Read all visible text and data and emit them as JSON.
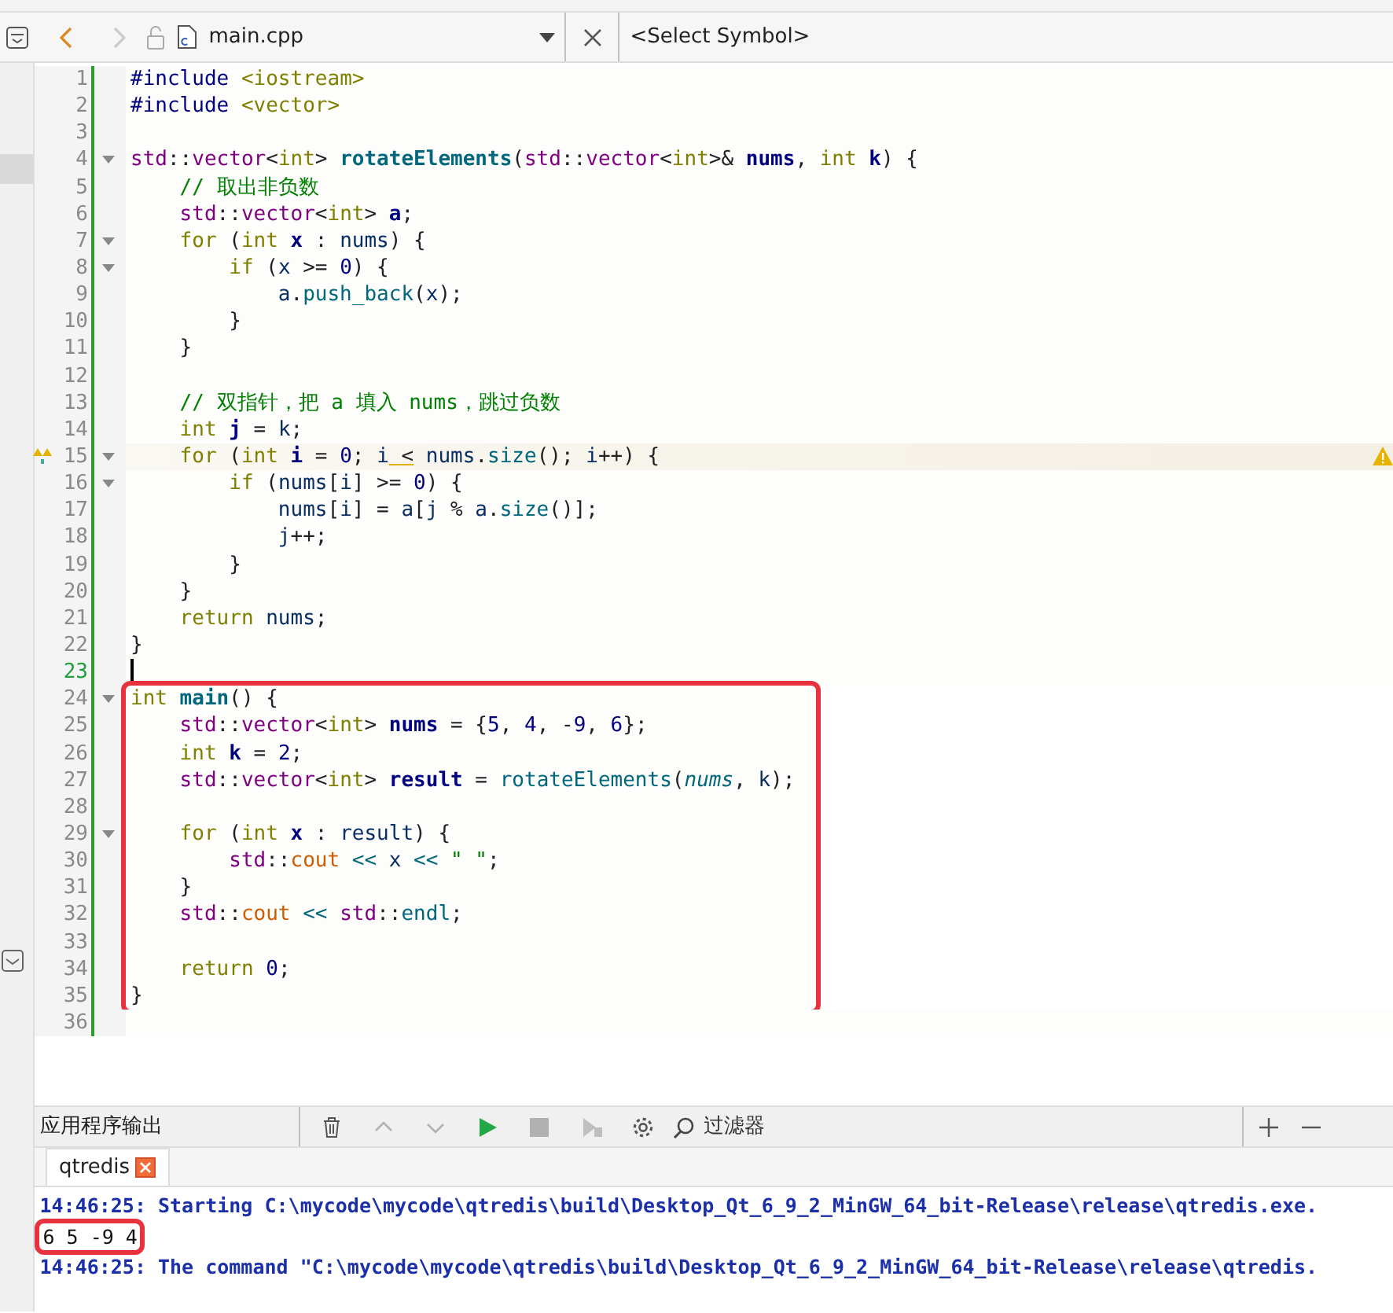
{
  "toolbar": {
    "nav": [
      {
        "kind": "back",
        "disabled": false
      },
      {
        "kind": "forward",
        "disabled": true
      }
    ],
    "file_name": "main.cpp",
    "symbol": "<Select Symbol>"
  },
  "editor": {
    "blocks": [
      {
        "boxed": false,
        "lines": [
          {
            "number": "1",
            "foldable": false,
            "warning": false,
            "current": false,
            "tokens": [
              {
                "text": "#include ",
                "kind": "pp"
              },
              {
                "text": "<iostream>",
                "kind": "inc"
              }
            ]
          },
          {
            "number": "2",
            "foldable": false,
            "warning": false,
            "current": false,
            "tokens": [
              {
                "text": "#include ",
                "kind": "pp"
              },
              {
                "text": "<vector>",
                "kind": "inc"
              }
            ]
          },
          {
            "number": "3",
            "foldable": false,
            "warning": false,
            "current": false
          },
          {
            "number": "4",
            "foldable": true,
            "warning": false,
            "current": false,
            "tokens": [
              {
                "text": "std",
                "kind": "type"
              },
              {
                "text": "::",
                "kind": "plain"
              },
              {
                "text": "vector",
                "kind": "type"
              },
              {
                "text": "<",
                "kind": "plain"
              },
              {
                "text": "int",
                "kind": "kw"
              },
              {
                "text": "> ",
                "kind": "plain"
              },
              {
                "text": "rotateElements",
                "kind": "fdecl"
              },
              {
                "text": "(",
                "kind": "plain"
              },
              {
                "text": "std",
                "kind": "type"
              },
              {
                "text": "::",
                "kind": "plain"
              },
              {
                "text": "vector",
                "kind": "type"
              },
              {
                "text": "<",
                "kind": "plain"
              },
              {
                "text": "int",
                "kind": "kw"
              },
              {
                "text": ">& ",
                "kind": "plain"
              },
              {
                "text": "nums",
                "kind": "decl"
              },
              {
                "text": ", ",
                "kind": "plain"
              },
              {
                "text": "int",
                "kind": "kw"
              },
              {
                "text": " k",
                "kind": "decl"
              },
              {
                "text": ") {",
                "kind": "plain"
              }
            ]
          },
          {
            "number": "5",
            "foldable": false,
            "warning": false,
            "current": false,
            "tokens": [
              {
                "text": "    // 取出非负数",
                "kind": "cmt"
              }
            ]
          },
          {
            "number": "6",
            "foldable": false,
            "warning": false,
            "current": false,
            "tokens": [
              {
                "text": "    std",
                "kind": "type"
              },
              {
                "text": "::",
                "kind": "plain"
              },
              {
                "text": "vector",
                "kind": "type"
              },
              {
                "text": "<",
                "kind": "plain"
              },
              {
                "text": "int",
                "kind": "kw"
              },
              {
                "text": "> ",
                "kind": "plain"
              },
              {
                "text": "a",
                "kind": "decl"
              },
              {
                "text": ";",
                "kind": "plain"
              }
            ]
          },
          {
            "number": "7",
            "foldable": true,
            "warning": false,
            "current": false,
            "tokens": [
              {
                "text": "    for",
                "kind": "kw"
              },
              {
                "text": " (",
                "kind": "plain"
              },
              {
                "text": "int",
                "kind": "kw"
              },
              {
                "text": " x",
                "kind": "decl"
              },
              {
                "text": " : ",
                "kind": "plain"
              },
              {
                "text": "nums",
                "kind": "var"
              },
              {
                "text": ") {",
                "kind": "plain"
              }
            ]
          },
          {
            "number": "8",
            "foldable": true,
            "warning": false,
            "current": false,
            "tokens": [
              {
                "text": "        if",
                "kind": "kw"
              },
              {
                "text": " (",
                "kind": "plain"
              },
              {
                "text": "x",
                "kind": "var"
              },
              {
                "text": " >= ",
                "kind": "plain"
              },
              {
                "text": "0",
                "kind": "num"
              },
              {
                "text": ") {",
                "kind": "plain"
              }
            ]
          },
          {
            "number": "9",
            "foldable": false,
            "warning": false,
            "current": false,
            "tokens": [
              {
                "text": "            a",
                "kind": "var"
              },
              {
                "text": ".",
                "kind": "plain"
              },
              {
                "text": "push_back",
                "kind": "func"
              },
              {
                "text": "(",
                "kind": "plain"
              },
              {
                "text": "x",
                "kind": "var"
              },
              {
                "text": ");",
                "kind": "plain"
              }
            ]
          },
          {
            "number": "10",
            "foldable": false,
            "warning": false,
            "current": false,
            "tokens": [
              {
                "text": "        }",
                "kind": "plain"
              }
            ]
          },
          {
            "number": "11",
            "foldable": false,
            "warning": false,
            "current": false,
            "tokens": [
              {
                "text": "    }",
                "kind": "plain"
              }
            ]
          },
          {
            "number": "12",
            "foldable": false,
            "warning": false,
            "current": false
          },
          {
            "number": "13",
            "foldable": false,
            "warning": false,
            "current": false,
            "tokens": [
              {
                "text": "    // 双指针，把 a 填入 nums，跳过负数",
                "kind": "cmt"
              }
            ]
          },
          {
            "number": "14",
            "foldable": false,
            "warning": false,
            "current": false,
            "tokens": [
              {
                "text": "    int",
                "kind": "kw"
              },
              {
                "text": " j",
                "kind": "decl"
              },
              {
                "text": " = ",
                "kind": "plain"
              },
              {
                "text": "k",
                "kind": "var"
              },
              {
                "text": ";",
                "kind": "plain"
              }
            ]
          },
          {
            "number": "15",
            "foldable": true,
            "warning": true,
            "current": false,
            "tokens": [
              {
                "text": "    for",
                "kind": "kw"
              },
              {
                "text": " (",
                "kind": "plain"
              },
              {
                "text": "int",
                "kind": "kw"
              },
              {
                "text": " i",
                "kind": "decl"
              },
              {
                "text": " = ",
                "kind": "plain"
              },
              {
                "text": "0",
                "kind": "num"
              },
              {
                "text": "; ",
                "kind": "plain"
              },
              {
                "text": "i",
                "kind": "var"
              },
              {
                "text": " <",
                "kind": "warn"
              },
              {
                "text": " nums",
                "kind": "var"
              },
              {
                "text": ".",
                "kind": "plain"
              },
              {
                "text": "size",
                "kind": "func"
              },
              {
                "text": "(); ",
                "kind": "plain"
              },
              {
                "text": "i",
                "kind": "var"
              },
              {
                "text": "++) {",
                "kind": "plain"
              }
            ]
          },
          {
            "number": "16",
            "foldable": true,
            "warning": false,
            "current": false,
            "tokens": [
              {
                "text": "        if",
                "kind": "kw"
              },
              {
                "text": " (",
                "kind": "plain"
              },
              {
                "text": "nums",
                "kind": "var"
              },
              {
                "text": "[",
                "kind": "plain"
              },
              {
                "text": "i",
                "kind": "var"
              },
              {
                "text": "] >= ",
                "kind": "plain"
              },
              {
                "text": "0",
                "kind": "num"
              },
              {
                "text": ") {",
                "kind": "plain"
              }
            ]
          },
          {
            "number": "17",
            "foldable": false,
            "warning": false,
            "current": false,
            "tokens": [
              {
                "text": "            nums",
                "kind": "var"
              },
              {
                "text": "[",
                "kind": "plain"
              },
              {
                "text": "i",
                "kind": "var"
              },
              {
                "text": "] = ",
                "kind": "plain"
              },
              {
                "text": "a",
                "kind": "var"
              },
              {
                "text": "[",
                "kind": "plain"
              },
              {
                "text": "j",
                "kind": "var"
              },
              {
                "text": " % ",
                "kind": "plain"
              },
              {
                "text": "a",
                "kind": "var"
              },
              {
                "text": ".",
                "kind": "plain"
              },
              {
                "text": "size",
                "kind": "func"
              },
              {
                "text": "()];",
                "kind": "plain"
              }
            ]
          },
          {
            "number": "18",
            "foldable": false,
            "warning": false,
            "current": false,
            "tokens": [
              {
                "text": "            j",
                "kind": "var"
              },
              {
                "text": "++;",
                "kind": "plain"
              }
            ]
          },
          {
            "number": "19",
            "foldable": false,
            "warning": false,
            "current": false,
            "tokens": [
              {
                "text": "        }",
                "kind": "plain"
              }
            ]
          },
          {
            "number": "20",
            "foldable": false,
            "warning": false,
            "current": false,
            "tokens": [
              {
                "text": "    }",
                "kind": "plain"
              }
            ]
          },
          {
            "number": "21",
            "foldable": false,
            "warning": false,
            "current": false,
            "tokens": [
              {
                "text": "    return",
                "kind": "kw"
              },
              {
                "text": " nums",
                "kind": "var"
              },
              {
                "text": ";",
                "kind": "plain"
              }
            ]
          },
          {
            "number": "22",
            "foldable": false,
            "warning": false,
            "current": false,
            "tokens": [
              {
                "text": "}",
                "kind": "plain"
              }
            ]
          },
          {
            "number": "23",
            "foldable": false,
            "warning": false,
            "current": true
          }
        ]
      },
      {
        "boxed": true,
        "lines": [
          {
            "number": "24",
            "foldable": true,
            "warning": false,
            "current": false,
            "tokens": [
              {
                "text": "int",
                "kind": "kw"
              },
              {
                "text": " main",
                "kind": "fdecl"
              },
              {
                "text": "() {",
                "kind": "plain"
              }
            ]
          },
          {
            "number": "25",
            "foldable": false,
            "warning": false,
            "current": false,
            "tokens": [
              {
                "text": "    std",
                "kind": "type"
              },
              {
                "text": "::",
                "kind": "plain"
              },
              {
                "text": "vector",
                "kind": "type"
              },
              {
                "text": "<",
                "kind": "plain"
              },
              {
                "text": "int",
                "kind": "kw"
              },
              {
                "text": "> ",
                "kind": "plain"
              },
              {
                "text": "nums",
                "kind": "decl"
              },
              {
                "text": " = {",
                "kind": "plain"
              },
              {
                "text": "5",
                "kind": "num"
              },
              {
                "text": ", ",
                "kind": "plain"
              },
              {
                "text": "4",
                "kind": "num"
              },
              {
                "text": ", -",
                "kind": "plain"
              },
              {
                "text": "9",
                "kind": "num"
              },
              {
                "text": ", ",
                "kind": "plain"
              },
              {
                "text": "6",
                "kind": "num"
              },
              {
                "text": "};",
                "kind": "plain"
              }
            ]
          },
          {
            "number": "26",
            "foldable": false,
            "warning": false,
            "current": false,
            "tokens": [
              {
                "text": "    int",
                "kind": "kw"
              },
              {
                "text": " k",
                "kind": "decl"
              },
              {
                "text": " = ",
                "kind": "plain"
              },
              {
                "text": "2",
                "kind": "num"
              },
              {
                "text": ";",
                "kind": "plain"
              }
            ]
          },
          {
            "number": "27",
            "foldable": false,
            "warning": false,
            "current": false,
            "tokens": [
              {
                "text": "    std",
                "kind": "type"
              },
              {
                "text": "::",
                "kind": "plain"
              },
              {
                "text": "vector",
                "kind": "type"
              },
              {
                "text": "<",
                "kind": "plain"
              },
              {
                "text": "int",
                "kind": "kw"
              },
              {
                "text": "> ",
                "kind": "plain"
              },
              {
                "text": "result",
                "kind": "decl"
              },
              {
                "text": " = ",
                "kind": "plain"
              },
              {
                "text": "rotateElements",
                "kind": "func"
              },
              {
                "text": "(",
                "kind": "plain"
              },
              {
                "text": "nums",
                "kind": "param"
              },
              {
                "text": ", ",
                "kind": "plain"
              },
              {
                "text": "k",
                "kind": "var"
              },
              {
                "text": ");",
                "kind": "plain"
              }
            ]
          },
          {
            "number": "28",
            "foldable": false,
            "warning": false,
            "current": false
          },
          {
            "number": "29",
            "foldable": true,
            "warning": false,
            "current": false,
            "tokens": [
              {
                "text": "    for",
                "kind": "kw"
              },
              {
                "text": " (",
                "kind": "plain"
              },
              {
                "text": "int",
                "kind": "kw"
              },
              {
                "text": " x",
                "kind": "decl"
              },
              {
                "text": " : ",
                "kind": "plain"
              },
              {
                "text": "result",
                "kind": "var"
              },
              {
                "text": ") {",
                "kind": "plain"
              }
            ]
          },
          {
            "number": "30",
            "foldable": false,
            "warning": false,
            "current": false,
            "tokens": [
              {
                "text": "        std",
                "kind": "type"
              },
              {
                "text": "::",
                "kind": "plain"
              },
              {
                "text": "cout",
                "kind": "stream"
              },
              {
                "text": " <<",
                "kind": "op"
              },
              {
                "text": " x",
                "kind": "var"
              },
              {
                "text": " <<",
                "kind": "op"
              },
              {
                "text": " \" \"",
                "kind": "str"
              },
              {
                "text": ";",
                "kind": "plain"
              }
            ]
          },
          {
            "number": "31",
            "foldable": false,
            "warning": false,
            "current": false,
            "tokens": [
              {
                "text": "    }",
                "kind": "plain"
              }
            ]
          },
          {
            "number": "32",
            "foldable": false,
            "warning": false,
            "current": false,
            "tokens": [
              {
                "text": "    std",
                "kind": "type"
              },
              {
                "text": "::",
                "kind": "plain"
              },
              {
                "text": "cout",
                "kind": "stream"
              },
              {
                "text": " <<",
                "kind": "op"
              },
              {
                "text": " std",
                "kind": "type"
              },
              {
                "text": "::",
                "kind": "plain"
              },
              {
                "text": "endl",
                "kind": "func"
              },
              {
                "text": ";",
                "kind": "plain"
              }
            ]
          },
          {
            "number": "33",
            "foldable": false,
            "warning": false,
            "current": false
          },
          {
            "number": "34",
            "foldable": false,
            "warning": false,
            "current": false,
            "tokens": [
              {
                "text": "    return",
                "kind": "kw"
              },
              {
                "text": " 0",
                "kind": "num"
              },
              {
                "text": ";",
                "kind": "plain"
              }
            ]
          },
          {
            "number": "35",
            "foldable": false,
            "warning": false,
            "current": false,
            "tokens": [
              {
                "text": "}",
                "kind": "plain"
              }
            ]
          }
        ]
      },
      {
        "lines": [
          {
            "number": "36",
            "foldable": false,
            "warning": false,
            "current": false
          }
        ]
      }
    ]
  },
  "output_panel": {
    "title": "应用程序输出",
    "tools": [
      {
        "kind": "clear",
        "disabled": false
      },
      {
        "kind": "up",
        "disabled": true
      },
      {
        "kind": "down",
        "disabled": true
      },
      {
        "kind": "run",
        "disabled": false
      },
      {
        "kind": "stop",
        "disabled": true
      },
      {
        "kind": "debug",
        "disabled": true
      },
      {
        "kind": "settings",
        "disabled": false
      }
    ],
    "filter": {
      "placeholder": "过滤器"
    },
    "tabs": [
      {
        "label": "qtredis",
        "selected": true
      }
    ],
    "lines": [
      {
        "kind": "info",
        "boxed": false,
        "text": "14:46:25: Starting C:\\mycode\\mycode\\qtredis\\build\\Desktop_Qt_6_9_2_MinGW_64_bit-Release\\release\\qtredis.exe."
      },
      {
        "kind": "stdout",
        "boxed": true,
        "text": "6 5 -9 4"
      },
      {
        "kind": "info",
        "boxed": false,
        "text": "14:46:25: The command \"C:\\mycode\\mycode\\qtredis\\build\\Desktop_Qt_6_9_2_MinGW_64_bit-Release\\release\\qtredis."
      }
    ]
  }
}
